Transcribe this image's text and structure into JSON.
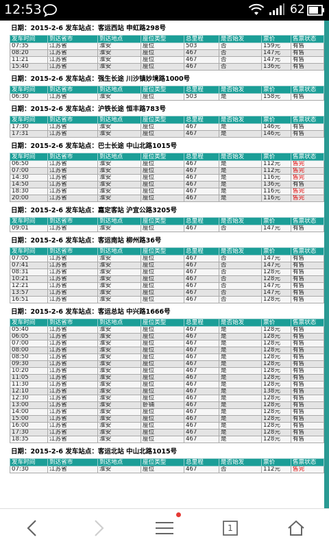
{
  "status_bar": {
    "time": "12:53",
    "battery": "62"
  },
  "columns": [
    "发车时间",
    "到达省市",
    "到达地点",
    "座位类型",
    "总里程",
    "是否始发",
    "票价",
    "售票状态"
  ],
  "stations": [
    {
      "title": "日期：2015-2-6  发车站点：客运西站  申虹路298号",
      "rows": [
        [
          "07:35",
          "江苏省",
          "淮安",
          "座位",
          "503",
          "否",
          "159元",
          "有售"
        ],
        [
          "08:20",
          "江苏省",
          "淮安",
          "座位",
          "467",
          "否",
          "147元",
          "有售"
        ],
        [
          "11:21",
          "江苏省",
          "淮安",
          "座位",
          "467",
          "否",
          "147元",
          "有售"
        ],
        [
          "15:40",
          "江苏省",
          "淮安",
          "座位",
          "467",
          "否",
          "136元",
          "有售"
        ]
      ]
    },
    {
      "title": "日期：2015-2-6  发车站点：强生长途  川沙镇妙境路1000号",
      "rows": [
        [
          "06:30",
          "江苏省",
          "淮安",
          "座位",
          "503",
          "是",
          "158元",
          "有售"
        ]
      ]
    },
    {
      "title": "日期：2015-2-6  发车站点：沪铁长途  恒丰路783号",
      "rows": [
        [
          "17:30",
          "江苏省",
          "淮安",
          "座位",
          "467",
          "是",
          "146元",
          "有售"
        ],
        [
          "17:31",
          "江苏省",
          "淮安",
          "座位",
          "467",
          "是",
          "146元",
          "有售"
        ]
      ]
    },
    {
      "title": "日期：2015-2-6  发车站点：巴士长途  中山北路1015号",
      "rows": [
        [
          "06:50",
          "江苏省",
          "淮安",
          "座位",
          "467",
          "是",
          "112元",
          "售完"
        ],
        [
          "07:00",
          "江苏省",
          "淮安",
          "座位",
          "467",
          "是",
          "112元",
          "售完"
        ],
        [
          "14:30",
          "江苏省",
          "淮安",
          "座位",
          "467",
          "是",
          "116元",
          "售完"
        ],
        [
          "14:50",
          "江苏省",
          "淮安",
          "座位",
          "467",
          "是",
          "136元",
          "有售"
        ],
        [
          "18:30",
          "江苏省",
          "淮安",
          "座位",
          "467",
          "是",
          "116元",
          "售完"
        ],
        [
          "20:00",
          "江苏省",
          "淮安",
          "座位",
          "467",
          "是",
          "116元",
          "售完"
        ]
      ]
    },
    {
      "title": "日期：2015-2-6  发车站点：嘉定客站  沪宜公路3205号",
      "rows": [
        [
          "09:01",
          "江苏省",
          "淮安",
          "座位",
          "467",
          "否",
          "147元",
          "有售"
        ]
      ]
    },
    {
      "title": "日期：2015-2-6  发车站点：客运南站  柳州路36号",
      "rows": [
        [
          "07:05",
          "江苏省",
          "淮安",
          "座位",
          "467",
          "否",
          "147元",
          "有售"
        ],
        [
          "07:41",
          "江苏省",
          "淮安",
          "座位",
          "467",
          "否",
          "147元",
          "有售"
        ],
        [
          "08:31",
          "江苏省",
          "淮安",
          "座位",
          "467",
          "否",
          "128元",
          "有售"
        ],
        [
          "10:21",
          "江苏省",
          "淮安",
          "座位",
          "467",
          "否",
          "128元",
          "有售"
        ],
        [
          "12:21",
          "江苏省",
          "淮安",
          "座位",
          "467",
          "否",
          "147元",
          "有售"
        ],
        [
          "13:57",
          "江苏省",
          "淮安",
          "座位",
          "467",
          "否",
          "147元",
          "有售"
        ],
        [
          "16:51",
          "江苏省",
          "淮安",
          "座位",
          "467",
          "否",
          "128元",
          "有售"
        ]
      ]
    },
    {
      "title": "日期：2015-2-6  发车站点：客运总站  中兴路1666号",
      "rows": [
        [
          "05:40",
          "江苏省",
          "淮安",
          "座位",
          "467",
          "是",
          "128元",
          "有售"
        ],
        [
          "06:05",
          "江苏省",
          "淮安",
          "座位",
          "467",
          "是",
          "128元",
          "有售"
        ],
        [
          "07:00",
          "江苏省",
          "淮安",
          "座位",
          "467",
          "是",
          "128元",
          "有售"
        ],
        [
          "08:00",
          "江苏省",
          "淮安",
          "座位",
          "467",
          "是",
          "128元",
          "有售"
        ],
        [
          "08:50",
          "江苏省",
          "淮安",
          "座位",
          "467",
          "是",
          "128元",
          "有售"
        ],
        [
          "09:30",
          "江苏省",
          "淮安",
          "座位",
          "467",
          "是",
          "128元",
          "有售"
        ],
        [
          "10:20",
          "江苏省",
          "淮安",
          "座位",
          "467",
          "是",
          "128元",
          "有售"
        ],
        [
          "11:05",
          "江苏省",
          "淮安",
          "座位",
          "467",
          "是",
          "128元",
          "有售"
        ],
        [
          "11:30",
          "江苏省",
          "淮安",
          "座位",
          "467",
          "是",
          "128元",
          "有售"
        ],
        [
          "12:10",
          "江苏省",
          "淮安",
          "座位",
          "467",
          "是",
          "138元",
          "有售"
        ],
        [
          "12:30",
          "江苏省",
          "淮安",
          "座位",
          "467",
          "是",
          "128元",
          "有售"
        ],
        [
          "13:00",
          "江苏省",
          "淮安",
          "卧铺",
          "467",
          "是",
          "128元",
          "有售"
        ],
        [
          "14:00",
          "江苏省",
          "淮安",
          "座位",
          "467",
          "是",
          "128元",
          "有售"
        ],
        [
          "15:00",
          "江苏省",
          "淮安",
          "座位",
          "467",
          "是",
          "128元",
          "有售"
        ],
        [
          "16:00",
          "江苏省",
          "淮安",
          "座位",
          "467",
          "是",
          "128元",
          "有售"
        ],
        [
          "17:30",
          "江苏省",
          "淮安",
          "座位",
          "467",
          "是",
          "128元",
          "有售"
        ],
        [
          "18:35",
          "江苏省",
          "淮安",
          "座位",
          "467",
          "是",
          "128元",
          "有售"
        ]
      ]
    },
    {
      "title": "日期：2015-2-6  发车站点：客运北站  中山北路1015号",
      "rows": [
        [
          "07:30",
          "江苏省",
          "淮安",
          "座位",
          "467",
          "否",
          "112元",
          "售完"
        ]
      ]
    }
  ],
  "navbar": {
    "tab_count": "1"
  },
  "colors": {
    "header_teal": "#1b9e97",
    "sold_out_red": "#e00000",
    "edge_teal": "#2a9a93"
  },
  "icons": [
    "chat-bubble-icon",
    "wifi-icon",
    "signal-icon",
    "battery-icon",
    "back-arrow-icon",
    "forward-arrow-icon",
    "menu-icon",
    "tabs-icon",
    "home-icon"
  ]
}
